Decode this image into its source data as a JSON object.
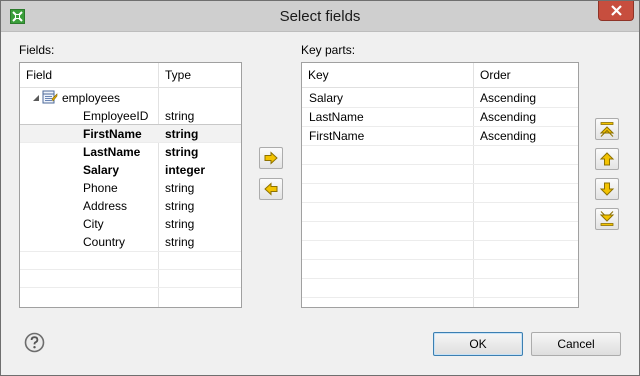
{
  "window": {
    "title": "Select fields"
  },
  "fields_panel": {
    "label": "Fields:",
    "columns": [
      "Field",
      "Type"
    ],
    "root": "employees",
    "rows": [
      {
        "field": "EmployeeID",
        "type": "string",
        "bold": false
      },
      {
        "field": "FirstName",
        "type": "string",
        "bold": true
      },
      {
        "field": "LastName",
        "type": "string",
        "bold": true
      },
      {
        "field": "Salary",
        "type": "integer",
        "bold": true
      },
      {
        "field": "Phone",
        "type": "string",
        "bold": false
      },
      {
        "field": "Address",
        "type": "string",
        "bold": false
      },
      {
        "field": "City",
        "type": "string",
        "bold": false
      },
      {
        "field": "Country",
        "type": "string",
        "bold": false
      }
    ]
  },
  "key_parts_panel": {
    "label": "Key parts:",
    "columns": [
      "Key",
      "Order"
    ],
    "rows": [
      {
        "key": "Salary",
        "order": "Ascending"
      },
      {
        "key": "LastName",
        "order": "Ascending"
      },
      {
        "key": "FirstName",
        "order": "Ascending"
      }
    ]
  },
  "buttons": {
    "ok": "OK",
    "cancel": "Cancel"
  },
  "icons": {
    "app": "app-icon",
    "close": "close-icon",
    "table": "table-icon",
    "add": "arrow-right-icon",
    "remove": "arrow-left-icon",
    "top": "move-top-icon",
    "up": "move-up-icon",
    "down": "move-down-icon",
    "bottom": "move-bottom-icon",
    "help": "help-icon"
  },
  "colors": {
    "accent": "#3c7fb1",
    "close": "#c74e3e",
    "arrow": "#e8b400"
  }
}
